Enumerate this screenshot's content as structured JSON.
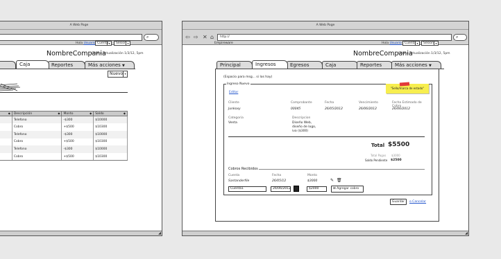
{
  "left_window": {
    "title": "A Web Page",
    "company": "NombreCompania",
    "last_update": "Último actualización 1/3/12, 5pm",
    "greeting": "Hola",
    "user_link": "Usuario",
    "dd_account": "Cuenta",
    "dd_session": "Sesion",
    "tabs": [
      "Caja",
      "Reportes",
      "Más acciones"
    ],
    "new_select": "Nuevo",
    "table": {
      "headers": [
        "Descripción",
        "Monto",
        "Saldo"
      ],
      "rows": [
        [
          "Telefono",
          "-$300",
          "$10000"
        ],
        [
          "Cobro",
          "+$500",
          "$10300"
        ],
        [
          "Telefono",
          "-$300",
          "$10000"
        ],
        [
          "Cobro",
          "+$500",
          "$10300"
        ],
        [
          "Telefono",
          "-$300",
          "$10000"
        ],
        [
          "Cobro",
          "+$500",
          "$10300"
        ]
      ]
    }
  },
  "right_window": {
    "title": "A Web Page",
    "url": "http://",
    "brand": "Empireware",
    "greeting": "Hola",
    "user_link": "Usuario",
    "dd_account": "Cuenta",
    "dd_session": "Sesion",
    "company": "NombreCompania",
    "last_update": "Último actualización 1/3/12, 5pm",
    "tabs": [
      "Principal",
      "Ingresos",
      "Egresos",
      "Caja",
      "Reportes",
      "Más acciones"
    ],
    "messages_placeholder": "(Espacio para msg... si los hay)",
    "fieldset_title": "Ingreso Nuevo",
    "sticky_note": "\"Sello/marca de estado\"",
    "edit_link": "Editar",
    "fields": {
      "cliente_label": "Cliente",
      "cliente_value": "Junkoxy",
      "comprobante_label": "Comprobante",
      "comprobante_value": "00045",
      "fecha_label": "Fecha",
      "fecha_value": "26/05/2012",
      "vencimiento_label": "Vencimiento",
      "vencimiento_value": "26/06/2012",
      "fecha_estimado_label": "Fecha Estimado de Cobro",
      "fecha_estimado_value": "26/06/2012",
      "categoria_label": "Categoria",
      "categoria_value": "Venta",
      "descripcion_label": "Descripcion",
      "descripcion_value_1": "Diseño Web,",
      "descripcion_value_2": "diseño de logo,",
      "descripcion_value_3": "iva ($300)"
    },
    "total_label": "Total",
    "total_value": "$5500",
    "total_pagos_label": "Total Pagos",
    "total_pagos_value": "$3000",
    "saldo_label": "Saldo Pendiente",
    "saldo_value": "$2500",
    "cobros_title": "Cobros Recibidos",
    "cobros_headers": [
      "Cuenta",
      "Fecha",
      "Monto"
    ],
    "cobros_row": [
      "Santanderfile",
      "26/05/12",
      "$3000"
    ],
    "new_cobro": {
      "cuenta": "Cuenta1",
      "fecha": "26/06/2012",
      "monto": "$2000"
    },
    "add_cobro_button": "Agregar cobro",
    "save_button": "Guardar",
    "cancel_link": "o Cancelar"
  },
  "colors": {
    "sticky": "#f7ee4f",
    "sticky_tape": "#e23a3a",
    "link": "#2255cc"
  }
}
